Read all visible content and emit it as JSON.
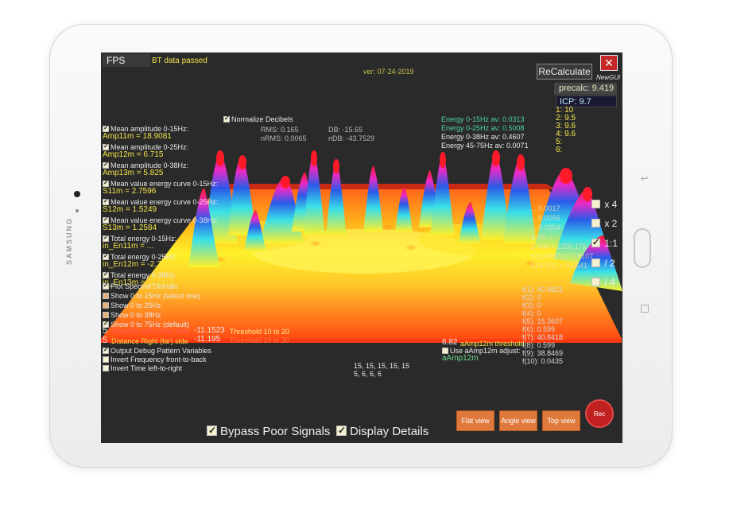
{
  "device": {
    "brand": "SAMSUNG"
  },
  "header": {
    "fps_label": "FPS",
    "bt_status": "BT data passed",
    "version": "ver: 07-24-2019",
    "recalc_label": "ReCalculate",
    "close_label": "✕",
    "newgui_label": "NewGUI",
    "precalc": "precalc: 9.419",
    "icp": "ICP: 9.7",
    "icp_list": [
      "1: 10",
      "2: 9.5",
      "3: 9.6",
      "4: 9.6",
      "5:",
      "6:"
    ]
  },
  "stats": {
    "normalize_label": "Normalize Decibels",
    "rms": "RMS: 0.165",
    "db": "DB: -15.65",
    "nrms": "nRMS: 0.0065",
    "ndb": "nDB: -43.7529"
  },
  "energy": [
    "Energy 0-15Hz av: 0.0313",
    "Energy 0-25Hz av: 0.5008",
    "Energy 0-38Hz av: 0.4607",
    "Energy 45-75Hz av: 0.0071"
  ],
  "left_panel": [
    {
      "label": "Mean amplitude 0-15Hz:",
      "value": "Amp11m = 18.9081"
    },
    {
      "label": "Mean amplitude 0-25Hz:",
      "value": "Amp12m = 6.715"
    },
    {
      "label": "Mean amplitude 0-38Hz:",
      "value": "Amp13m = 5.825"
    },
    {
      "label": "Mean value energy curve 0-15Hz:",
      "value": "S11m = 2.7596"
    },
    {
      "label": "Mean value energy curve 0-25Hz:",
      "value": "S12m = 1.5249"
    },
    {
      "label": "Mean value energy curve 0-38Hz:",
      "value": "S13m = 1.2584"
    },
    {
      "label": "Total energy 0-15Hz:",
      "value": "in_En11m = ..."
    },
    {
      "label": "Total energy 0-25Hz:",
      "value": "in_En12m = -2.7..."
    },
    {
      "label": "Total energy 0-38Hz:",
      "value": "in_En13m = -3.1473"
    }
  ],
  "plot_options": {
    "plot_spectral": "Plot Spectral Domain",
    "items": [
      "Show 0 to 15Hz (select one)",
      "Show 0 to 25Hz",
      "Show 0 to 38Hz",
      "Show 0 to 75Hz (default)"
    ]
  },
  "distance": {
    "left_num": "5",
    "left_label": "Distance Left (near) side",
    "left_val": "-11.1523",
    "left_threshold": "Threshold 10 to 20",
    "right_num": "5",
    "right_label": "Distance Right (far) side",
    "right_val": "-11.195",
    "right_threshold": "Threshold 20 to 30"
  },
  "debug_options": [
    "Output Debug Pattern Variables",
    "Invert Frequency front-to-back",
    "Invert Time left-to-right"
  ],
  "sequence": [
    "15, 15, 15, 15, 15",
    "5, 6, 6, 6"
  ],
  "amp_threshold": {
    "value": "6.82",
    "label": "aAmp12m threshold",
    "use_label": "Use aAmp12m adjust:",
    "name": "aAmp12m"
  },
  "f_values": [
    "f(1): 40.9821",
    "f(2): 0",
    "f(3): 0",
    "f(4): 0",
    "f(5): 15.3607",
    "f(6): 0.599",
    "f(7): 40.8418",
    "f(8): 0.599",
    "f(9): 38.8469",
    "f(10): 0.0435"
  ],
  "right_overlay": [
    "... 0.0017",
    "... 0.0256",
    "... 0.0354",
    "S:KK = ...",
    "S: KK = 1205.175",
    "S11/AMP11: 0.8107",
    "S14-S11 = 0.0541"
  ],
  "zoom": [
    "x 4",
    "x 2",
    "1:1",
    "/ 2",
    "/ 4"
  ],
  "view_buttons": [
    "Flat view",
    "Angle view",
    "Top view"
  ],
  "rec_label": "Rec",
  "bottom": {
    "bypass": "Bypass Poor Signals",
    "display": "Display Details"
  },
  "colors": {
    "screen_bg": "#2a2a2a",
    "button_orange": "#e07a3c",
    "rec_red": "#c0201f",
    "label_yellow": "#f2e44a"
  }
}
